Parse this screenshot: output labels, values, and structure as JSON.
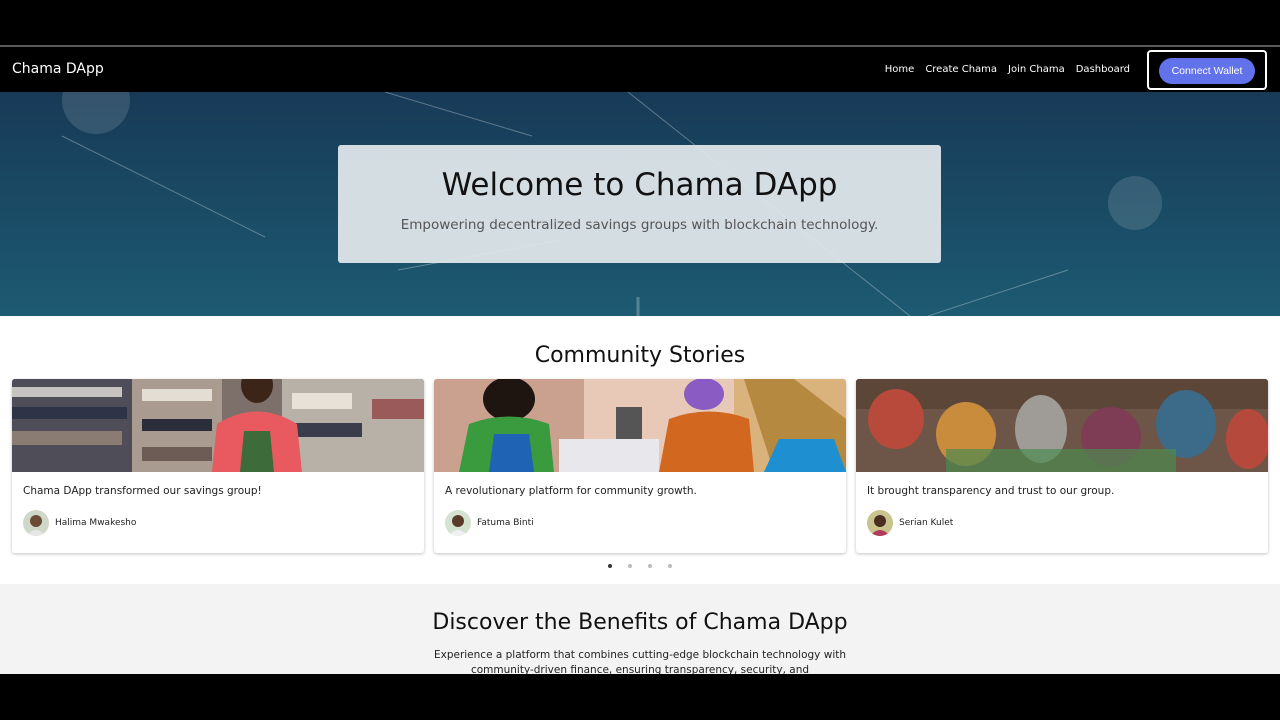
{
  "navbar": {
    "brand": "Chama DApp",
    "links": [
      "Home",
      "Create Chama",
      "Join Chama",
      "Dashboard"
    ],
    "connect_wallet": "Connect Wallet"
  },
  "hero": {
    "title": "Welcome to Chama DApp",
    "subtitle": "Empowering decentralized savings groups with blockchain technology."
  },
  "stories": {
    "title": "Community Stories",
    "cards": [
      {
        "quote": "Chama DApp transformed our savings group!",
        "author": "Halima Mwakesho"
      },
      {
        "quote": "A revolutionary platform for community growth.",
        "author": "Fatuma Binti"
      },
      {
        "quote": "It brought transparency and trust to our group.",
        "author": "Serian Kulet"
      }
    ],
    "carousel": {
      "slides": 4,
      "active": 1
    }
  },
  "benefits": {
    "title": "Discover the Benefits of Chama DApp",
    "text": "Experience a platform that combines cutting-edge blockchain technology with community-driven finance, ensuring transparency, security, and"
  },
  "colors": {
    "accent": "#6272ea",
    "hero_top": "#173a57",
    "hero_bottom": "#1d5a72"
  }
}
